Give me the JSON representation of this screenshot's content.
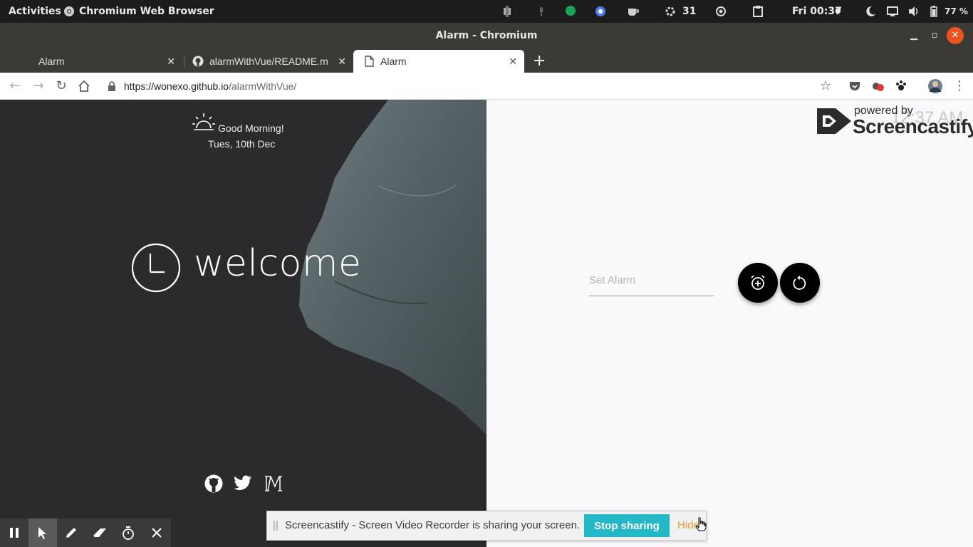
{
  "topbar": {
    "activities": "Activities",
    "app_name": "Chromium Web Browser",
    "badge_count": "31",
    "clock": "Fri 00:37",
    "battery": "77 %"
  },
  "window": {
    "title": "Alarm - Chromium"
  },
  "tabs": [
    {
      "label": "Alarm"
    },
    {
      "label": "alarmWithVue/README.m"
    },
    {
      "label": "Alarm"
    }
  ],
  "address": {
    "host": "https://wonexo.github.io",
    "path": "/alarmWithVue/"
  },
  "hero": {
    "greeting": "Good Morning!",
    "date": "Tues, 10th Dec",
    "welcome": "welcome"
  },
  "alarm": {
    "placeholder": "Set Alarm",
    "time_display": "12:37 AM"
  },
  "watermark": {
    "powered_by": "powered by",
    "brand": "Screencastify"
  },
  "share_bar": {
    "message": "Screencastify - Screen Video Recorder is sharing your screen.",
    "stop_label": "Stop sharing",
    "hide_label": "Hide"
  }
}
